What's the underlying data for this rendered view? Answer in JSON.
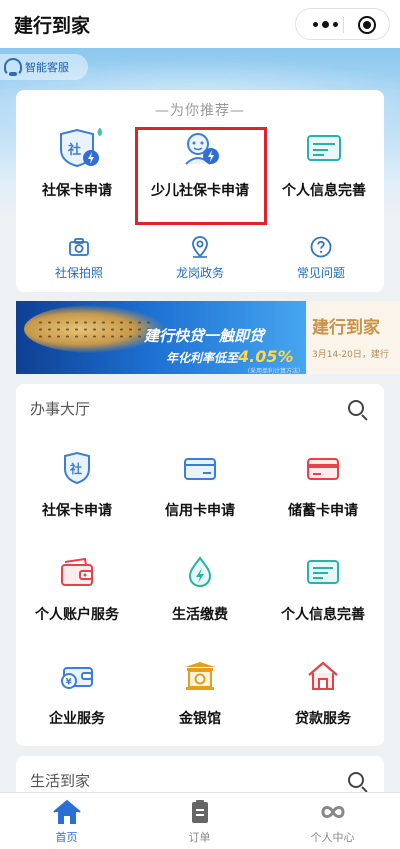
{
  "app": {
    "title": "建行到家"
  },
  "customer_service": {
    "label": "智能客服"
  },
  "recommend": {
    "title": "—为你推荐—",
    "main_items": [
      {
        "label": "社保卡申请",
        "icon": "social-security-card-icon"
      },
      {
        "label": "少儿社保卡申请",
        "icon": "child-social-security-card-icon"
      },
      {
        "label": "个人信息完善",
        "icon": "personal-info-card-icon"
      }
    ],
    "sub_items": [
      {
        "label": "社保拍照",
        "icon": "camera-icon"
      },
      {
        "label": "龙岗政务",
        "icon": "government-location-icon"
      },
      {
        "label": "常见问题",
        "icon": "question-icon"
      }
    ]
  },
  "banner": {
    "headline": "建行快贷一触即贷",
    "rate_prefix": "年化利率低至",
    "rate_value": "4.05%",
    "note": "（采用单利计算方法）",
    "side_title": "建行到家",
    "side_date": "3月14-20日，建行"
  },
  "service_hall": {
    "title": "办事大厅",
    "items": [
      {
        "label": "社保卡申请",
        "icon": "social-security-icon",
        "color": "#3a7fd5"
      },
      {
        "label": "信用卡申请",
        "icon": "credit-card-icon",
        "color": "#3a7fd5"
      },
      {
        "label": "储蓄卡申请",
        "icon": "debit-card-icon",
        "color": "#e8414a"
      },
      {
        "label": "个人账户服务",
        "icon": "wallet-icon",
        "color": "#e8414a"
      },
      {
        "label": "生活缴费",
        "icon": "utility-payment-icon",
        "color": "#28b3a8"
      },
      {
        "label": "个人信息完善",
        "icon": "personal-info-icon",
        "color": "#28b3a8"
      },
      {
        "label": "企业服务",
        "icon": "enterprise-wallet-icon",
        "color": "#3a7fd5"
      },
      {
        "label": "金银馆",
        "icon": "gold-silver-hall-icon",
        "color": "#e0a21c"
      },
      {
        "label": "贷款服务",
        "icon": "loan-house-icon",
        "color": "#e8414a"
      }
    ]
  },
  "life": {
    "title": "生活到家"
  },
  "tabs": [
    {
      "label": "首页",
      "icon": "home-icon",
      "active": true
    },
    {
      "label": "订单",
      "icon": "order-icon",
      "active": false
    },
    {
      "label": "个人中心",
      "icon": "profile-icon",
      "active": false
    }
  ],
  "colors": {
    "brand_blue": "#2a6fd6",
    "highlight_red": "#e0232a",
    "accent_red": "#e8414a",
    "accent_teal": "#28b3a8",
    "accent_gold": "#e0a21c"
  }
}
